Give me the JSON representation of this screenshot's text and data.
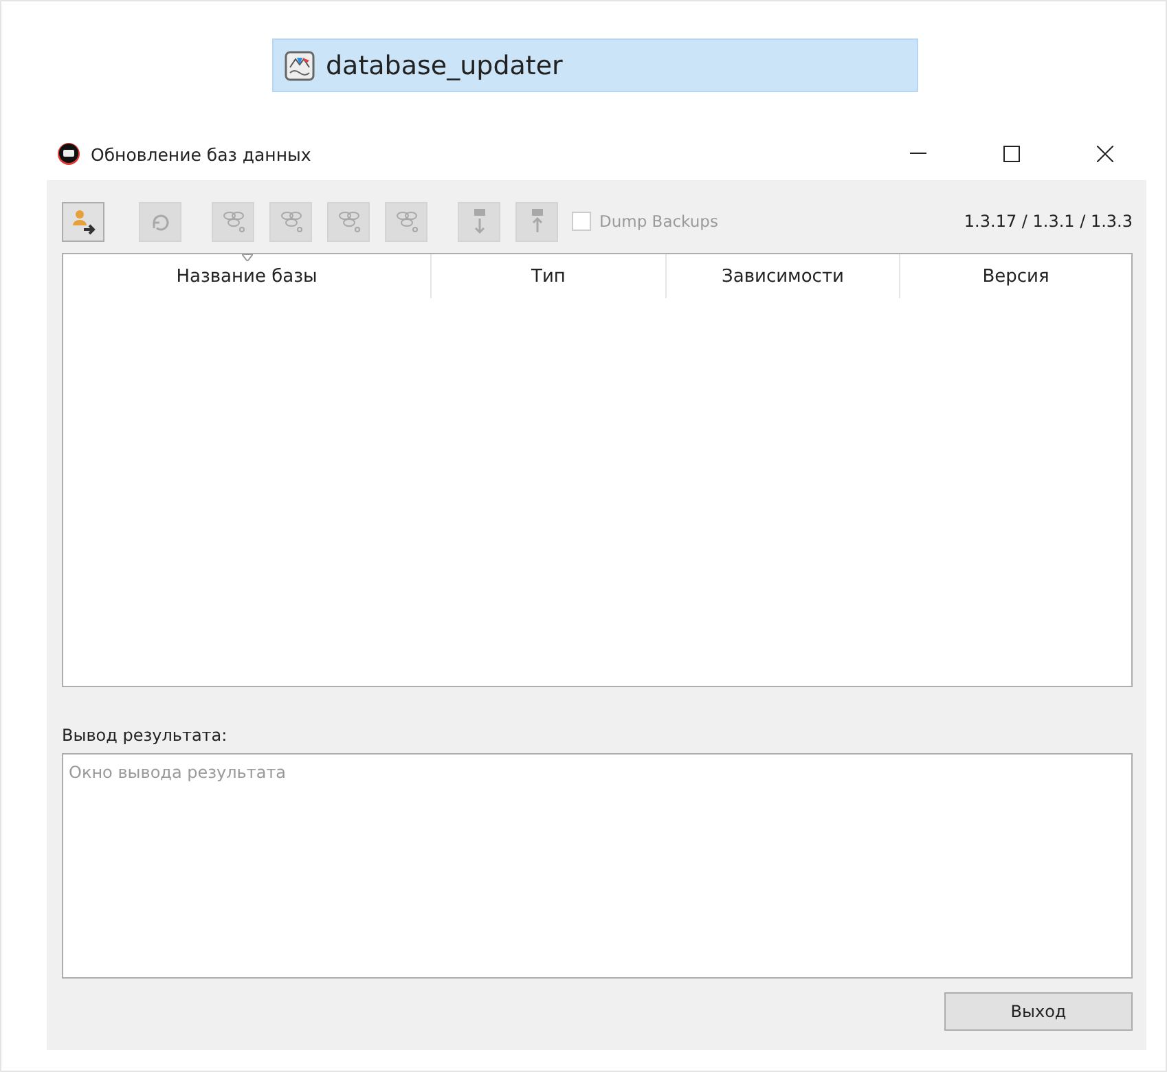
{
  "taskbar_item": {
    "title": "database_updater",
    "selected": true
  },
  "window": {
    "title": "Обновление баз данных"
  },
  "toolbar": {
    "buttons": [
      {
        "kind": "user-arrow",
        "disabled": false
      },
      {
        "kind": "refresh",
        "disabled": true
      },
      {
        "kind": "db-remove",
        "disabled": true
      },
      {
        "kind": "db-add",
        "disabled": true
      },
      {
        "kind": "db-edit",
        "disabled": true
      },
      {
        "kind": "db-settings",
        "disabled": true
      },
      {
        "kind": "down",
        "disabled": true
      },
      {
        "kind": "up",
        "disabled": true
      }
    ],
    "dump_backups": {
      "label": "Dump Backups",
      "checked": false,
      "disabled": true
    },
    "version": "1.3.17 / 1.3.1 / 1.3.3"
  },
  "table": {
    "columns": [
      {
        "label": "Название базы",
        "sorted": true
      },
      {
        "label": "Тип",
        "sorted": false
      },
      {
        "label": "Зависимости",
        "sorted": false
      },
      {
        "label": "Версия",
        "sorted": false
      }
    ]
  },
  "output": {
    "label": "Вывод результата:",
    "placeholder": "Окно вывода результата"
  },
  "buttons": [
    {
      "label": "Выход"
    }
  ]
}
